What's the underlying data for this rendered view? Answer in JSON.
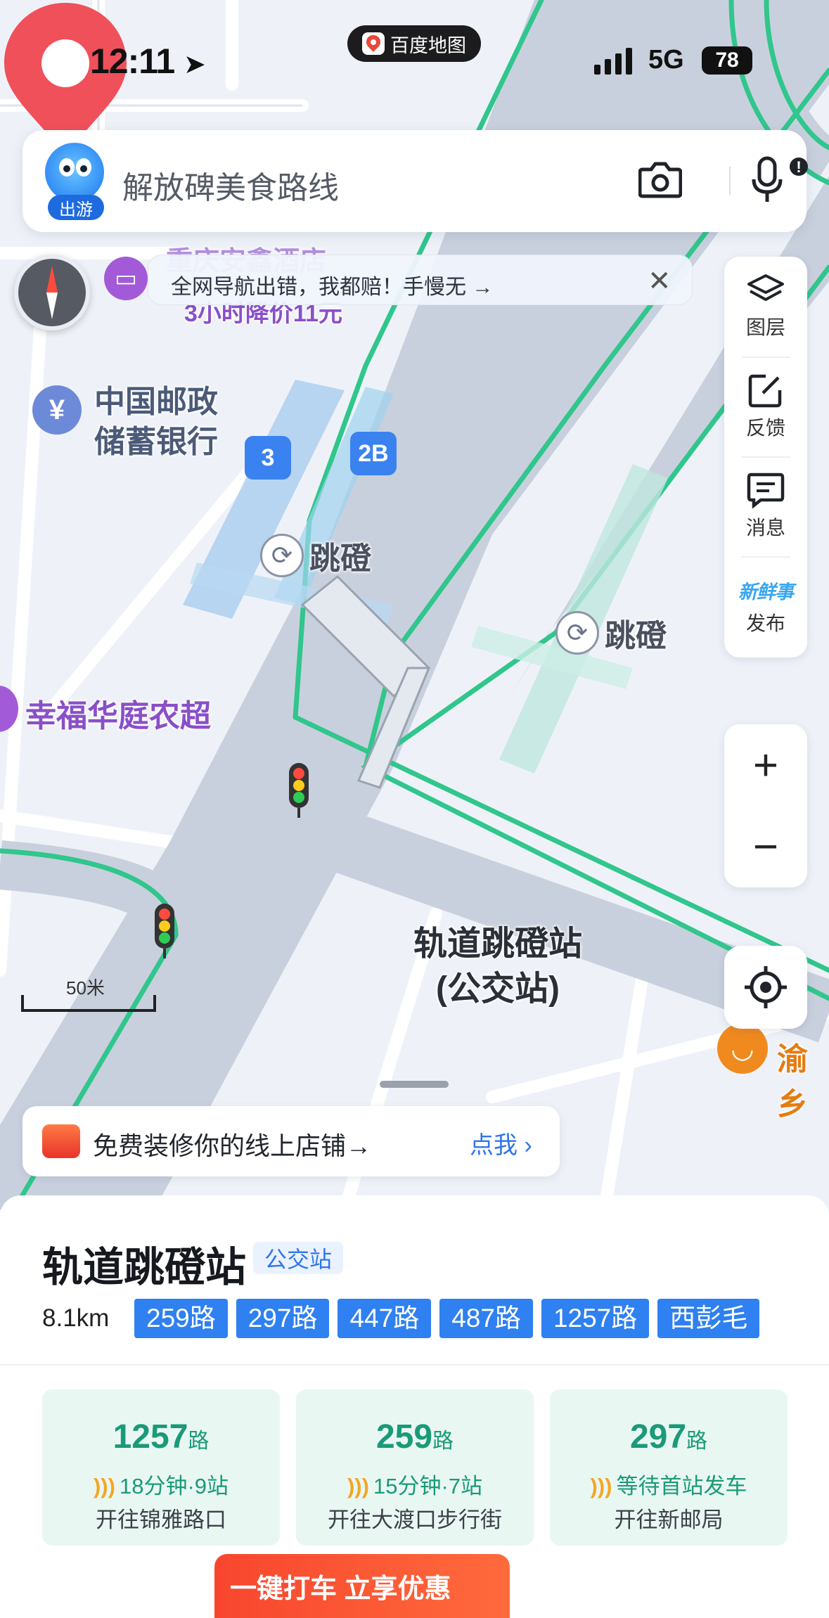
{
  "status_bar": {
    "time": "12:11",
    "app_name": "百度地图",
    "network": "5G",
    "battery": "78"
  },
  "search": {
    "avatar_tag": "出游",
    "placeholder": "解放碑美食路线"
  },
  "banner": {
    "text": "全网导航出错，我都赔！手慢无 →"
  },
  "side_panel": {
    "items": [
      {
        "label": "图层",
        "icon": "layers-icon"
      },
      {
        "label": "反馈",
        "icon": "edit-icon"
      },
      {
        "label": "消息",
        "icon": "message-icon"
      },
      {
        "label": "发布",
        "icon": "xinxianshi-icon",
        "badge": "新鲜事"
      }
    ]
  },
  "zoom": {
    "in": "+",
    "out": "−"
  },
  "map": {
    "scale_label": "50米",
    "poi_hotel_name": "重庆安鑫酒店",
    "poi_hotel_deal": "3小时降价11元",
    "poi_bank_line1": "中国邮政",
    "poi_bank_line2": "储蓄银行",
    "poi_station_a": "跳磴",
    "poi_station_b": "跳磴",
    "poi_market": "幸福华庭农超",
    "poi_restaurant": "渝乡",
    "entrance_3": "3",
    "entrance_2b": "2B",
    "pin_label_line1": "轨道跳磴站",
    "pin_label_line2": "(公交站)"
  },
  "shop_chip": {
    "text": "免费装修你的线上店铺→",
    "action": "点我"
  },
  "stop": {
    "name": "轨道跳磴站",
    "type": "公交站",
    "distance": "8.1km",
    "routes": [
      "259路",
      "297路",
      "447路",
      "487路",
      "1257路",
      "西彭毛"
    ],
    "cards": [
      {
        "num": "1257",
        "unit": "路",
        "eta": "18分钟·9站",
        "direction": "开往锦雅路口"
      },
      {
        "num": "259",
        "unit": "路",
        "eta": "15分钟·7站",
        "direction": "开往大渡口步行街"
      },
      {
        "num": "297",
        "unit": "路",
        "eta": "等待首站发车",
        "direction": "开往新邮局"
      }
    ]
  },
  "promo": {
    "text": "一键打车 立享优惠"
  },
  "colors": {
    "accent_blue": "#2f80f0",
    "route_green": "#30c68c",
    "pin_red": "#f0505a",
    "poi_purple": "#8a4fc8"
  }
}
